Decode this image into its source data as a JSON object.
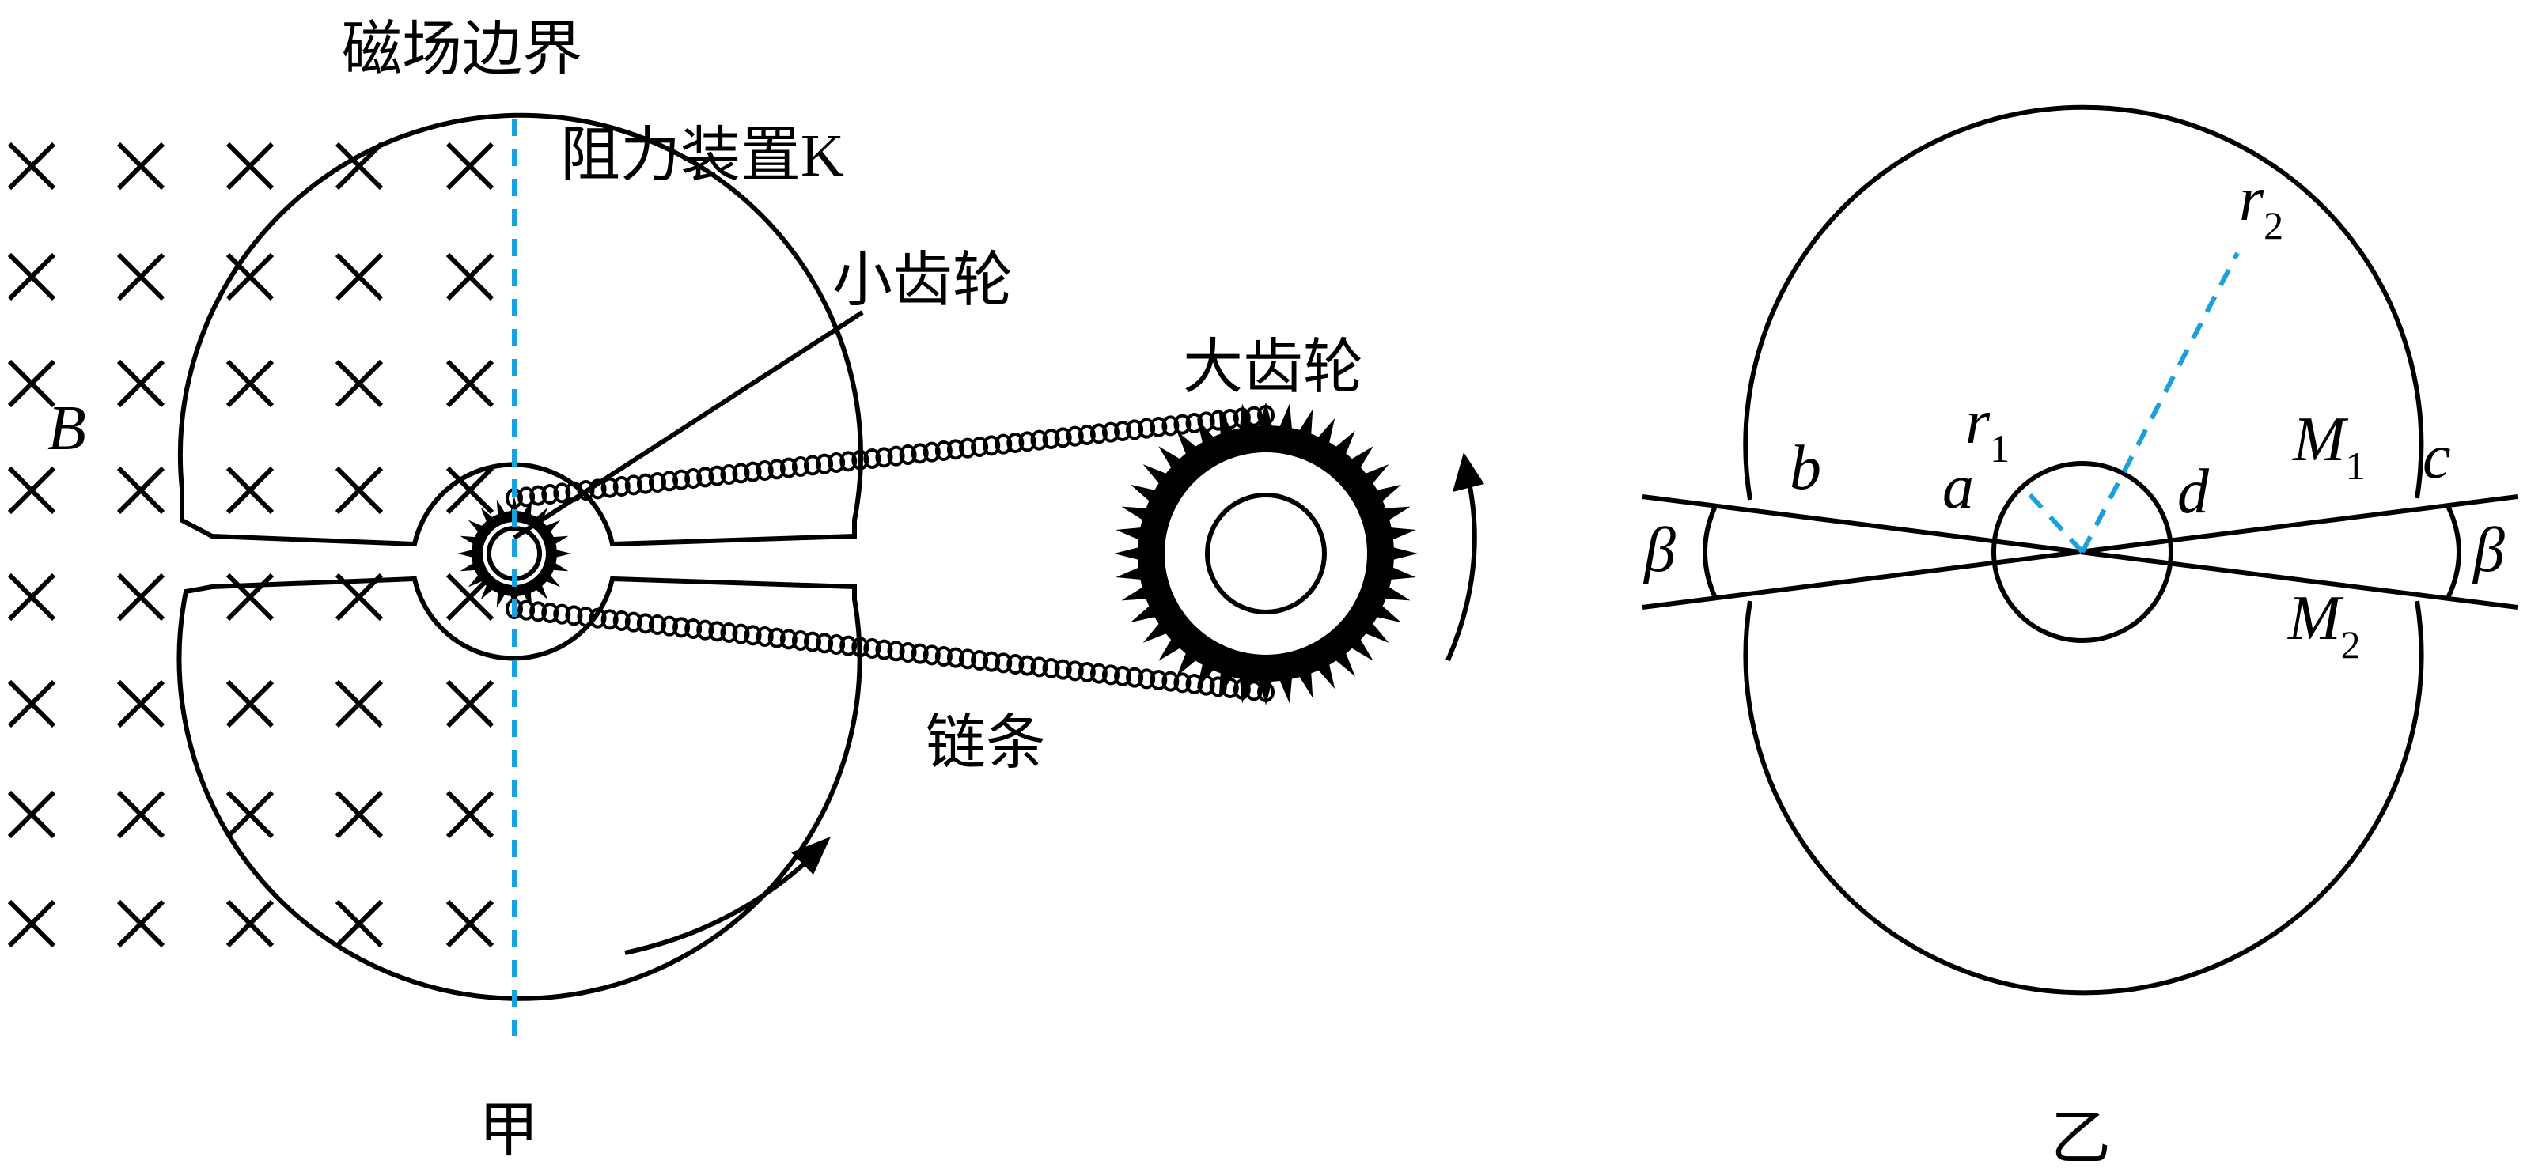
{
  "labels": {
    "boundary": "磁场边界",
    "device": "阻力装置",
    "device_letter": "K",
    "small_gear": "小齿轮",
    "big_gear": "大齿轮",
    "chain": "链条",
    "field": "B",
    "fig_left": "甲",
    "fig_right": "乙"
  },
  "right_labels": {
    "b": "b",
    "a": "a",
    "d": "d",
    "c": "c",
    "r1": "r",
    "r1_sub": "1",
    "r2": "r",
    "r2_sub": "2",
    "M1": "M",
    "M1_sub": "1",
    "M2": "M",
    "M2_sub": "2",
    "beta_left": "β",
    "beta_right": "β"
  },
  "colors": {
    "dashed_line": "#1aa0dc",
    "ink": "#000000"
  },
  "icons": {
    "field_symbol": "cross-mark",
    "rotation_arrows": "curved-arrow"
  }
}
